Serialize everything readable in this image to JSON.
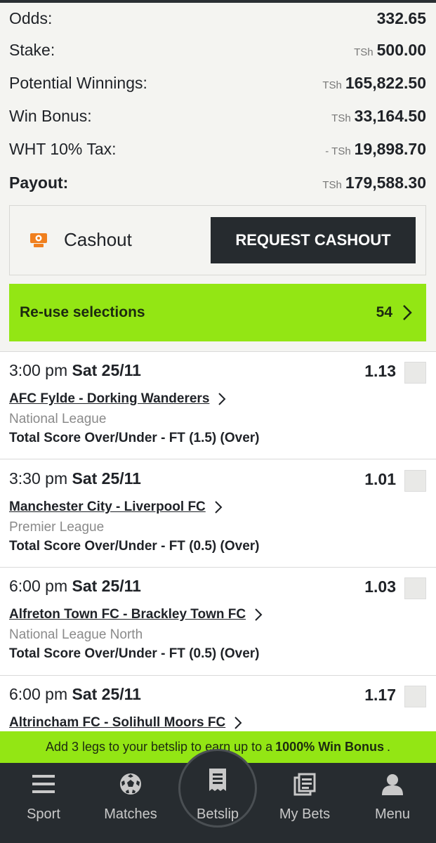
{
  "summary": {
    "odds_label": "Odds:",
    "odds_value": "332.65",
    "stake_label": "Stake:",
    "stake_currency": "TSh",
    "stake_value": "500.00",
    "potential_label": "Potential Winnings:",
    "potential_currency": "TSh",
    "potential_value": "165,822.50",
    "bonus_label": "Win Bonus:",
    "bonus_currency": "TSh",
    "bonus_value": "33,164.50",
    "tax_label": "WHT 10% Tax:",
    "tax_currency": "- TSh",
    "tax_value": "19,898.70",
    "payout_label": "Payout:",
    "payout_currency": "TSh",
    "payout_value": "179,588.30"
  },
  "cashout": {
    "label": "Cashout",
    "button": "REQUEST CASHOUT",
    "icon": "cashout-icon",
    "icon_color": "#f07f1e"
  },
  "reuse": {
    "label": "Re-use selections",
    "count": "54"
  },
  "selections": [
    {
      "time": "3:00 pm",
      "date": "Sat 25/11",
      "odds": "1.13",
      "match": "AFC Fylde - Dorking Wanderers",
      "league": "National League",
      "market": "Total Score Over/Under - FT (1.5) (Over)"
    },
    {
      "time": "3:30 pm",
      "date": "Sat 25/11",
      "odds": "1.01",
      "match": "Manchester City - Liverpool FC",
      "league": "Premier League",
      "market": "Total Score Over/Under - FT (0.5) (Over)"
    },
    {
      "time": "6:00 pm",
      "date": "Sat 25/11",
      "odds": "1.03",
      "match": "Alfreton Town FC - Brackley Town FC",
      "league": "National League North",
      "market": "Total Score Over/Under - FT (0.5) (Over)"
    },
    {
      "time": "6:00 pm",
      "date": "Sat 25/11",
      "odds": "1.17",
      "match": "Altrincham FC - Solihull Moors FC",
      "league": "",
      "market": ""
    }
  ],
  "bonus_bar": {
    "prefix": "Add 3 legs to your betslip to earn up to a",
    "highlight": "1000% Win Bonus",
    "suffix": "."
  },
  "nav": {
    "sport": "Sport",
    "matches": "Matches",
    "betslip": "Betslip",
    "mybets": "My Bets",
    "menu": "Menu"
  },
  "colors": {
    "accent_green": "#93e614",
    "dark": "#272c30",
    "cashout_orange": "#f07f1e"
  }
}
